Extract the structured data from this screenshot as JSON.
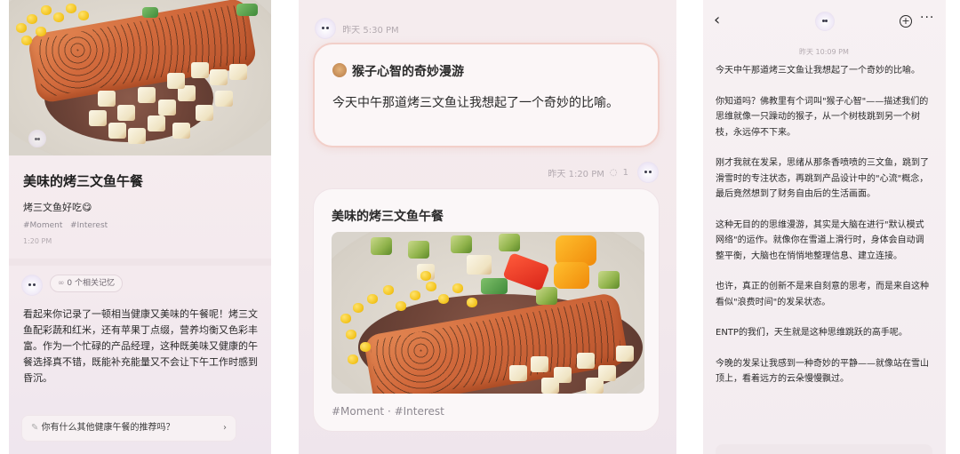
{
  "panel1": {
    "photo_badge": "",
    "title": "美味的烤三文鱼午餐",
    "subtitle": "烤三文鱼好吃😋",
    "tags": [
      "#Moment",
      "#Interest"
    ],
    "time": "1:20 PM",
    "memory_chip": "0 个相关记忆",
    "reply": "看起来你记录了一顿相当健康又美味的午餐呢！烤三文鱼配彩蔬和红米，还有苹果丁点缀，营养均衡又色彩丰富。作为一个忙碌的产品经理，这种既美味又健康的午餐选择真不错，既能补充能量又不会让下午工作时感到昏沉。",
    "suggestion": "你有什么其他健康午餐的推荐吗？",
    "suggestion_chevron": "›"
  },
  "panel2": {
    "header_time": "昨天 5:30 PM",
    "card1_title": "猴子心智的奇妙漫游",
    "card1_body": "今天中午那道烤三文鱼让我想起了一个奇妙的比喻。",
    "meta_time": "昨天 1:20 PM",
    "meta_count": "1",
    "card2_title": "美味的烤三文鱼午餐",
    "card2_tags": "#Moment · #Interest"
  },
  "panel3": {
    "back": "‹",
    "plus": "+",
    "more": "···",
    "time": "昨天 10:09 PM",
    "paragraphs": [
      "今天中午那道烤三文鱼让我想起了一个奇妙的比喻。",
      "你知道吗？佛教里有个词叫\"猴子心智\"——描述我们的思维就像一只躁动的猴子，从一个树枝跳到另一个树枝，永远停不下来。",
      "刚才我就在发呆，思绪从那条香喷喷的三文鱼，跳到了滑雪时的专注状态，再跳到产品设计中的\"心流\"概念，最后竟然想到了财务自由后的生活画面。",
      "这种无目的的思维漫游，其实是大脑在进行\"默认模式网络\"的运作。就像你在雪道上滑行时，身体会自动调整平衡，大脑也在悄悄地整理信息、建立连接。",
      "也许，真正的创新不是来自刻意的思考，而是来自这种看似\"浪费时间\"的发呆状态。",
      "ENTP的我们，天生就是这种思维跳跃的高手呢。",
      "今晚的发呆让我感到一种奇妙的平静——就像站在雪山顶上，看着远方的云朵慢慢飘过。"
    ]
  },
  "icons": [
    "ai-avatar-icon",
    "memory-icon",
    "comment-icon",
    "bulb-icon",
    "back-icon",
    "plus-circle-icon",
    "more-icon",
    "monkey-icon"
  ]
}
